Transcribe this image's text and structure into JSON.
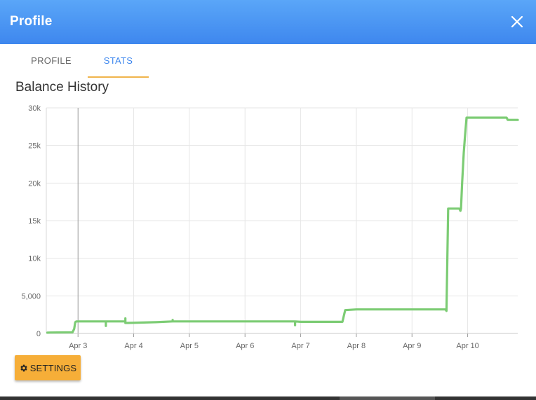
{
  "header": {
    "title": "Profile",
    "background": "#4a96f4",
    "close_icon": "close-icon"
  },
  "tabs": [
    {
      "label": "PROFILE",
      "active": false
    },
    {
      "label": "STATS",
      "active": true,
      "indicator_color": "#f0b44c",
      "color": "#3e87ee"
    }
  ],
  "chart_title": "Balance History",
  "chart_data": {
    "type": "line",
    "title": "Balance History",
    "xlabel": "",
    "ylabel": "",
    "color": "#7ccc74",
    "grid": true,
    "legend": "none",
    "x_tick_labels": [
      "Apr 3",
      "Apr 4",
      "Apr 5",
      "Apr 6",
      "Apr 7",
      "Apr 8",
      "Apr 9",
      "Apr 10"
    ],
    "x_tick_values": [
      3,
      4,
      5,
      6,
      7,
      8,
      9,
      10
    ],
    "xlim": [
      2.43,
      10.9
    ],
    "y_tick_labels": [
      "0",
      "5,000",
      "10k",
      "15k",
      "20k",
      "25k",
      "30k"
    ],
    "y_tick_values": [
      0,
      5000,
      10000,
      15000,
      20000,
      25000,
      30000
    ],
    "ylim": [
      0,
      30000
    ],
    "series": [
      {
        "x": [
          2.45,
          2.5,
          2.9,
          2.93,
          2.95,
          2.97,
          3.2,
          3.5,
          3.5,
          3.5,
          3.5,
          3.85,
          3.85,
          3.85,
          3.9,
          4.4,
          4.7,
          4.7,
          4.7,
          5.0,
          5.5,
          6.0,
          6.5,
          6.9,
          6.9,
          6.9,
          7.0,
          7.75,
          7.8,
          8.0,
          9.0,
          9.6,
          9.62,
          9.65,
          9.67,
          9.85,
          9.87,
          9.88,
          9.9,
          9.93,
          9.95,
          9.98,
          10.7,
          10.72,
          10.9
        ],
        "y": [
          100,
          120,
          150,
          600,
          1500,
          1600,
          1600,
          1600,
          1000,
          1600,
          1600,
          1600,
          2000,
          1400,
          1400,
          1500,
          1600,
          1800,
          1600,
          1600,
          1600,
          1600,
          1600,
          1600,
          1100,
          1600,
          1550,
          1550,
          3100,
          3200,
          3200,
          3200,
          3000,
          16600,
          16600,
          16600,
          16300,
          16600,
          20000,
          24000,
          26000,
          28700,
          28700,
          28400,
          28400
        ]
      }
    ]
  },
  "settings_button": {
    "label": "SETTINGS",
    "icon": "gear-icon",
    "color": "#f6ae38"
  }
}
